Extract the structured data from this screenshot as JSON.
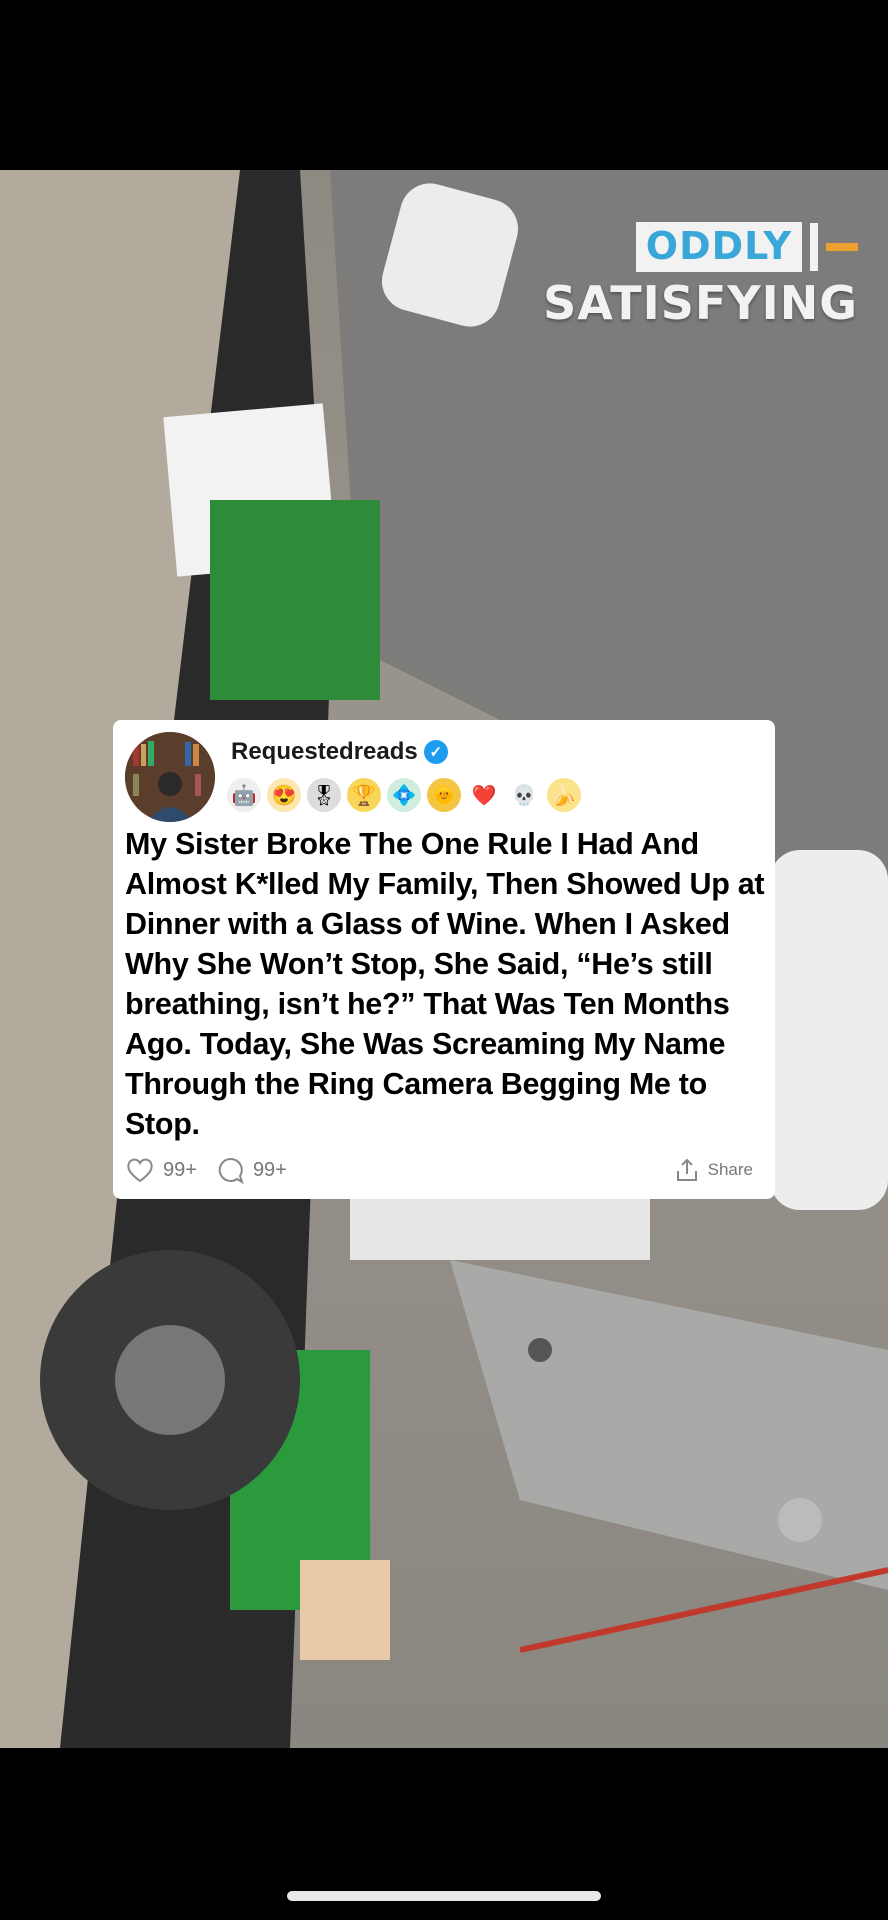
{
  "watermark": {
    "line1": "ODDLY",
    "line2": "SATISFYING"
  },
  "post": {
    "username": "Requestedreads",
    "verified_icon": "verified-check-icon",
    "awards": [
      "robot-award-icon",
      "heart-eyes-award-icon",
      "medal-award-icon",
      "gold-trophy-award-icon",
      "platinum-award-icon",
      "sun-award-icon",
      "heart-award-icon",
      "skull-award-icon",
      "banana-award-icon"
    ],
    "title": "My Sister Broke The One Rule I Had And Almost K*lled My Family, Then Showed Up at Dinner with a Glass of Wine. When I Asked Why She Won’t Stop, She Said, “He’s still breathing, isn’t he?” That Was Ten Months Ago. Today, She Was Screaming My Name Through the Ring Camera Begging Me to Stop.",
    "likes": "99+",
    "comments": "99+",
    "share_label": "Share"
  },
  "colors": {
    "oddly_text": "#3aa7d9",
    "accent_dash": "#f0a030",
    "verified": "#1d9bf0"
  }
}
